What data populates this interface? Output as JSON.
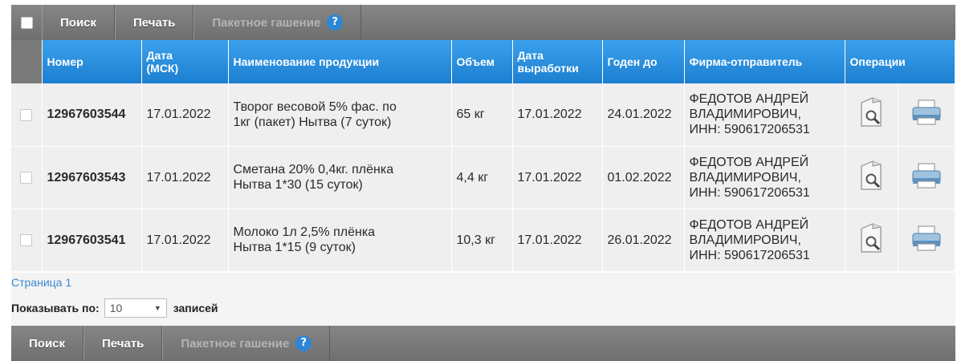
{
  "toolbar_top": {
    "search_label": "Поиск",
    "print_label": "Печать",
    "batch_label": "Пакетное гашение",
    "help_glyph": "?"
  },
  "table": {
    "headers": {
      "number": "Номер",
      "date_line1": "Дата",
      "date_line2": "(МСК)",
      "product": "Наименование продукции",
      "volume": "Объем",
      "prod_date_line1": "Дата",
      "prod_date_line2": "выработки",
      "valid_until": "Годен до",
      "sender": "Фирма-отправитель",
      "operations": "Операции"
    },
    "rows": [
      {
        "number": "12967603544",
        "date": "17.01.2022",
        "product_line1": "Творог весовой 5% фас. по",
        "product_line2": "1кг (пакет) Нытва (7 суток)",
        "volume": "65 кг",
        "prod_date": "17.01.2022",
        "valid_until": "24.01.2022",
        "sender_line1": "ФЕДОТОВ АНДРЕЙ",
        "sender_line2": "ВЛАДИМИРОВИЧ,",
        "sender_line3": "ИНН: 590617206531"
      },
      {
        "number": "12967603543",
        "date": "17.01.2022",
        "product_line1": "Сметана 20% 0,4кг. плёнка",
        "product_line2": "Нытва 1*30 (15 суток)",
        "volume": "4,4 кг",
        "prod_date": "17.01.2022",
        "valid_until": "01.02.2022",
        "sender_line1": "ФЕДОТОВ АНДРЕЙ",
        "sender_line2": "ВЛАДИМИРОВИЧ,",
        "sender_line3": "ИНН: 590617206531"
      },
      {
        "number": "12967603541",
        "date": "17.01.2022",
        "product_line1": "Молоко 1л 2,5% плёнка",
        "product_line2": "Нытва 1*15 (9 суток)",
        "volume": "10,3 кг",
        "prod_date": "17.01.2022",
        "valid_until": "26.01.2022",
        "sender_line1": "ФЕДОТОВ АНДРЕЙ",
        "sender_line2": "ВЛАДИМИРОВИЧ,",
        "sender_line3": "ИНН: 590617206531"
      }
    ]
  },
  "pager": {
    "page_label": "Страница 1",
    "show_by_label": "Показывать по:",
    "page_size_value": "10",
    "records_label": "записей"
  },
  "toolbar_bottom": {
    "search_label": "Поиск",
    "print_label": "Печать",
    "batch_label": "Пакетное гашение",
    "help_glyph": "?"
  },
  "icons": {
    "view": "document-magnifier-icon",
    "print": "printer-icon"
  },
  "colors": {
    "header_blue": "#1d7fd0",
    "toolbar_gray": "#7a7a7a",
    "link_blue": "#3a8ad0",
    "help_blue": "#2e86d4"
  }
}
